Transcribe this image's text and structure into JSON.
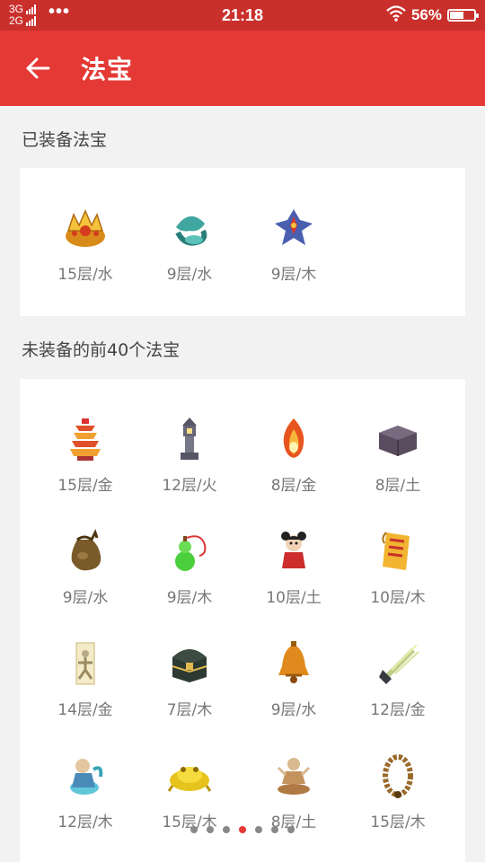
{
  "status_bar": {
    "net1": "3G",
    "net2": "2G",
    "menu_dots": "•••",
    "time": "21:18",
    "battery_text": "56%",
    "battery_level": 0.56
  },
  "app_bar": {
    "title": "法宝",
    "back_icon": "arrow-left-icon"
  },
  "equipped": {
    "heading": "已装备法宝",
    "items": [
      {
        "label": "15层/水",
        "icon": "golden-crown-icon"
      },
      {
        "label": "9层/水",
        "icon": "jade-dragon-icon"
      },
      {
        "label": "9层/木",
        "icon": "winged-ornament-icon"
      }
    ]
  },
  "unequipped": {
    "heading": "未装备的前40个法宝",
    "items": [
      {
        "label": "15层/金",
        "icon": "pagoda-icon"
      },
      {
        "label": "12层/火",
        "icon": "stone-lantern-icon"
      },
      {
        "label": "8层/金",
        "icon": "flame-orb-icon"
      },
      {
        "label": "8层/土",
        "icon": "stone-box-icon"
      },
      {
        "label": "9层/水",
        "icon": "cloth-sack-icon"
      },
      {
        "label": "9层/木",
        "icon": "green-gourd-icon"
      },
      {
        "label": "10层/土",
        "icon": "doll-icon"
      },
      {
        "label": "10层/木",
        "icon": "scroll-talisman-icon"
      },
      {
        "label": "14层/金",
        "icon": "paper-figure-icon"
      },
      {
        "label": "7层/木",
        "icon": "treasure-chest-icon"
      },
      {
        "label": "9层/水",
        "icon": "bronze-bell-icon"
      },
      {
        "label": "12层/金",
        "icon": "flying-sword-icon"
      },
      {
        "label": "12层/木",
        "icon": "spirit-figure-icon"
      },
      {
        "label": "15层/木",
        "icon": "golden-toad-icon"
      },
      {
        "label": "8层/土",
        "icon": "meditating-monk-icon"
      },
      {
        "label": "15层/木",
        "icon": "prayer-beads-icon"
      }
    ]
  },
  "pager": {
    "count": 7,
    "active_index": 3
  }
}
